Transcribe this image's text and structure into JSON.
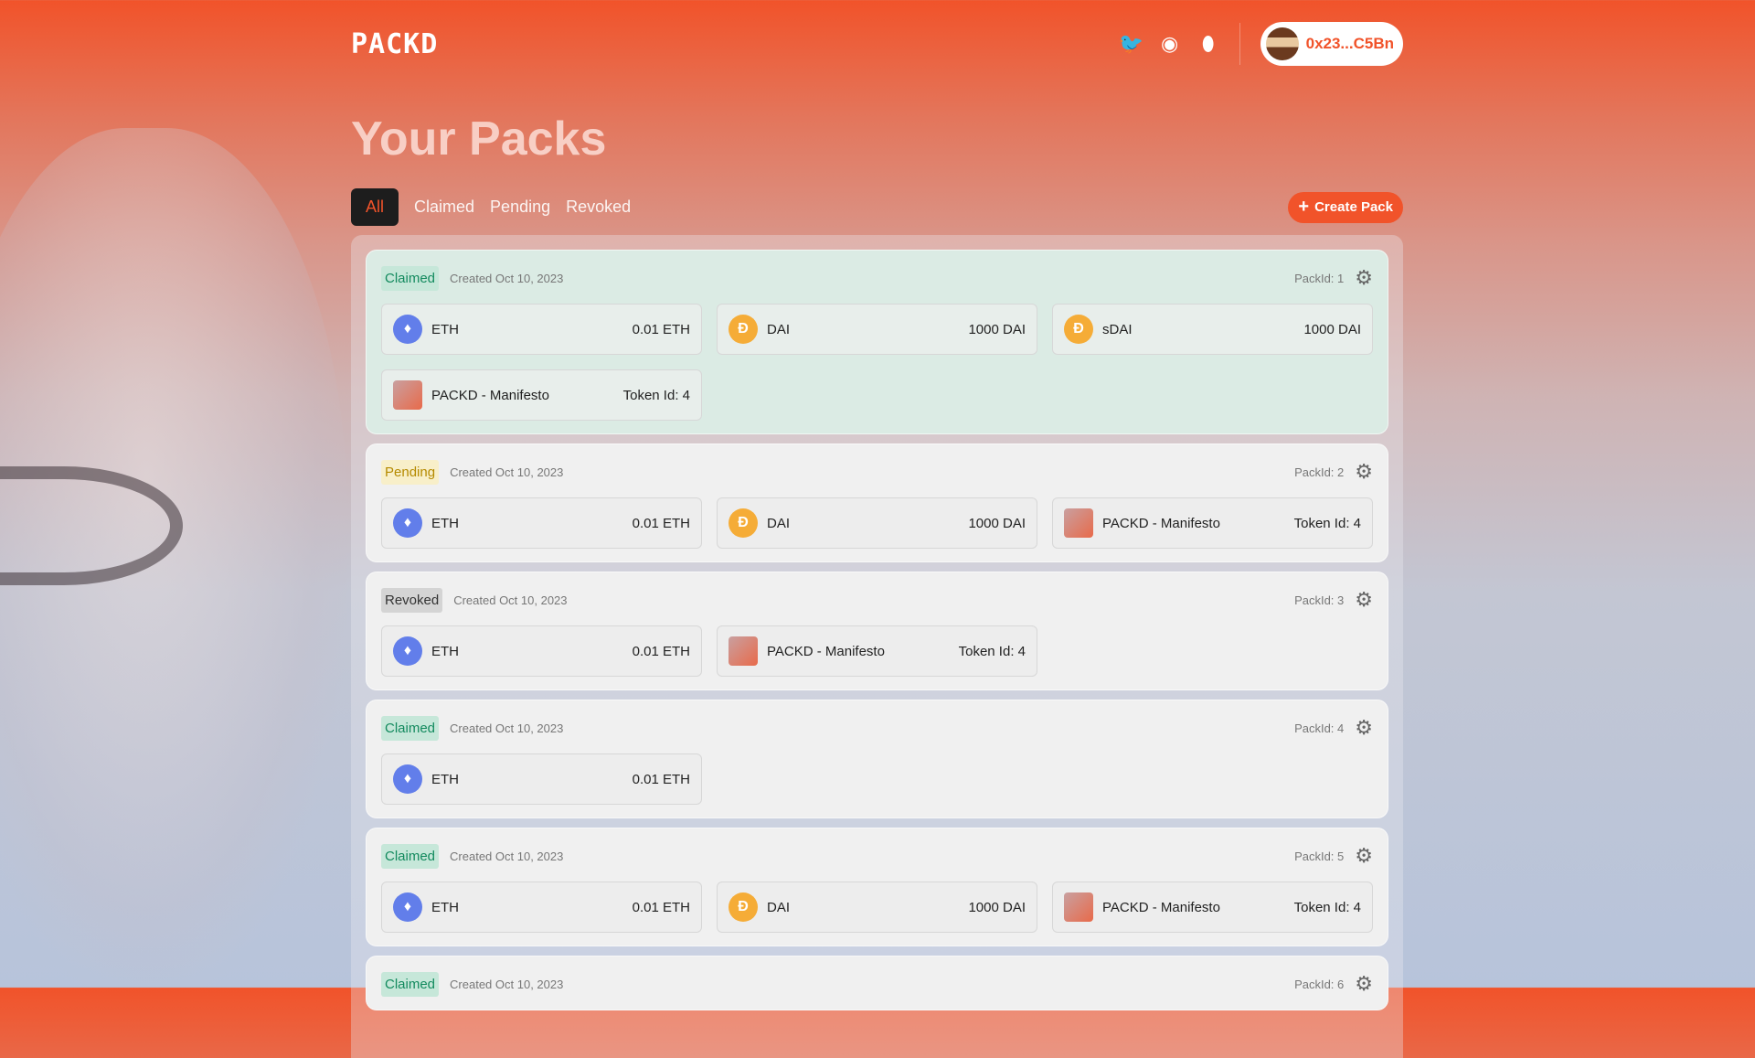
{
  "header": {
    "logo": "PACKD",
    "wallet": "0x23...C5Bn",
    "icons": [
      "twitter-icon",
      "discord-icon",
      "notification-icon"
    ]
  },
  "title": "Your Packs",
  "tabs": [
    "All",
    "Claimed",
    "Pending",
    "Revoked"
  ],
  "create_label": "Create Pack",
  "colors": {
    "accent": "#f1532a"
  },
  "packs": [
    {
      "status": "Claimed",
      "created": "Created Oct 10, 2023",
      "pack_id": "PackId: 1",
      "assets": [
        {
          "type": "eth",
          "name": "ETH",
          "value": "0.01 ETH"
        },
        {
          "type": "dai",
          "name": "DAI",
          "value": "1000 DAI"
        },
        {
          "type": "dai",
          "name": "sDAI",
          "value": "1000 DAI"
        },
        {
          "type": "nft",
          "name": "PACKD - Manifesto",
          "value": "Token Id: 4"
        }
      ]
    },
    {
      "status": "Pending",
      "created": "Created Oct 10, 2023",
      "pack_id": "PackId: 2",
      "assets": [
        {
          "type": "eth",
          "name": "ETH",
          "value": "0.01 ETH"
        },
        {
          "type": "dai",
          "name": "DAI",
          "value": "1000 DAI"
        },
        {
          "type": "nft",
          "name": "PACKD - Manifesto",
          "value": "Token Id: 4"
        }
      ]
    },
    {
      "status": "Revoked",
      "created": "Created Oct 10, 2023",
      "pack_id": "PackId: 3",
      "assets": [
        {
          "type": "eth",
          "name": "ETH",
          "value": "0.01 ETH"
        },
        {
          "type": "nft",
          "name": "PACKD - Manifesto",
          "value": "Token Id: 4"
        }
      ]
    },
    {
      "status": "Claimed",
      "created": "Created Oct 10, 2023",
      "pack_id": "PackId: 4",
      "assets": [
        {
          "type": "eth",
          "name": "ETH",
          "value": "0.01 ETH"
        }
      ]
    },
    {
      "status": "Claimed",
      "created": "Created Oct 10, 2023",
      "pack_id": "PackId: 5",
      "assets": [
        {
          "type": "eth",
          "name": "ETH",
          "value": "0.01 ETH"
        },
        {
          "type": "dai",
          "name": "DAI",
          "value": "1000 DAI"
        },
        {
          "type": "nft",
          "name": "PACKD - Manifesto",
          "value": "Token Id: 4"
        }
      ]
    },
    {
      "status": "Claimed",
      "created": "Created Oct 10, 2023",
      "pack_id": "PackId: 6",
      "assets": []
    }
  ]
}
